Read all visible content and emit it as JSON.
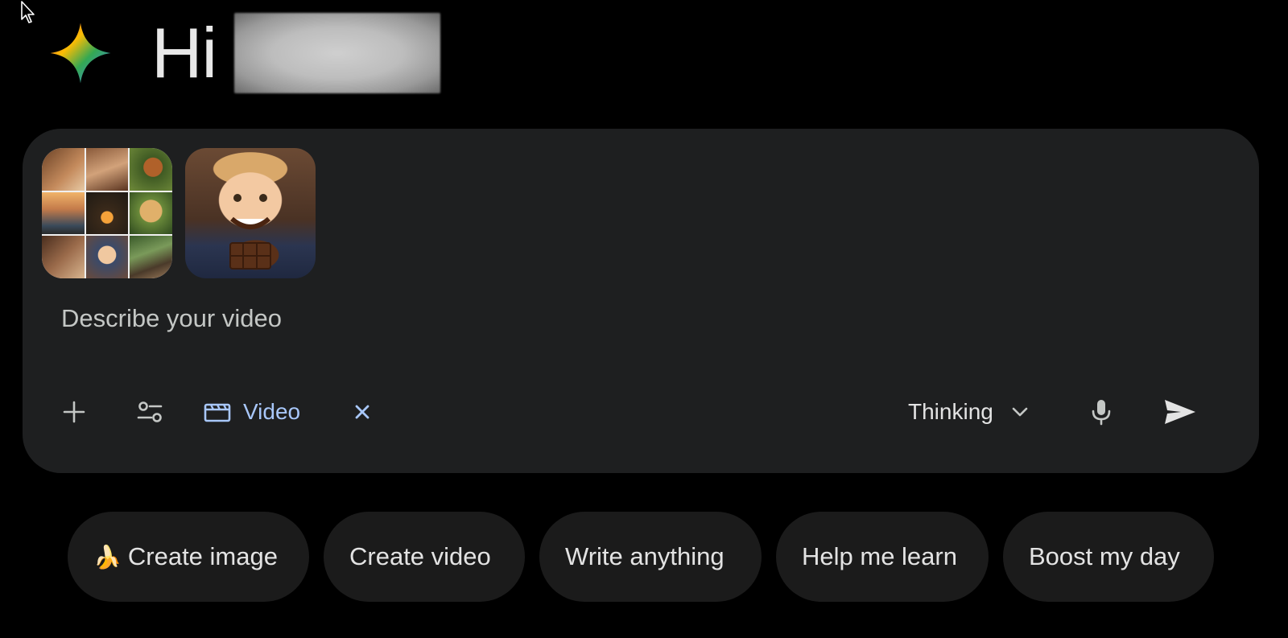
{
  "header": {
    "greeting": "Hi"
  },
  "composer": {
    "attachments": [
      {
        "name": "collage-attachment"
      },
      {
        "name": "kid-chocolate-attachment"
      }
    ],
    "placeholder": "Describe your video",
    "active_tool": {
      "label": "Video",
      "icon": "clapperboard-icon"
    },
    "mode": {
      "label": "Thinking"
    }
  },
  "suggestions": [
    {
      "label": "Create image",
      "icon": "🍌"
    },
    {
      "label": "Create video"
    },
    {
      "label": "Write anything"
    },
    {
      "label": "Help me learn"
    },
    {
      "label": "Boost my day"
    }
  ],
  "colors": {
    "background": "#000000",
    "composer": "#1e1f20",
    "chip": "#1b1b1b",
    "accent": "#a8c7fa",
    "text": "#e3e3e3"
  }
}
